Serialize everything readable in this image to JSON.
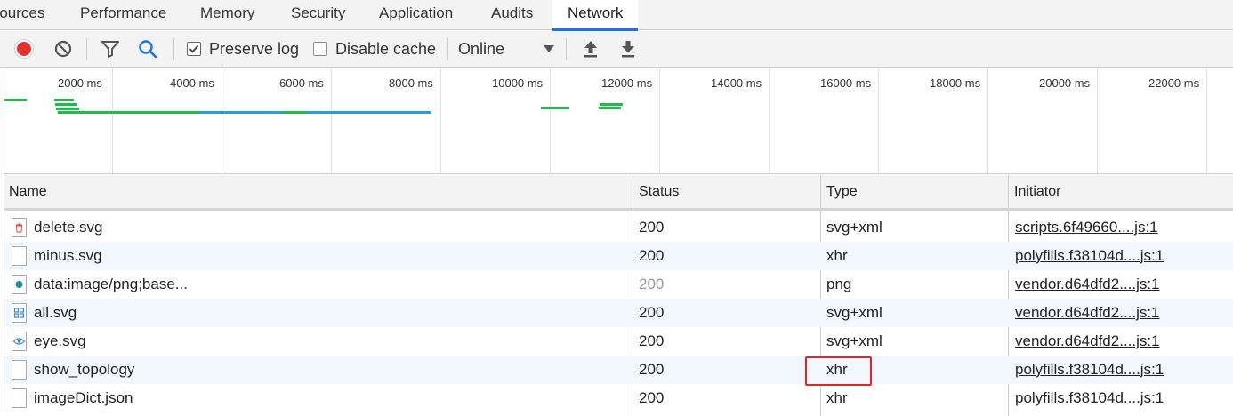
{
  "tabs": [
    "Sources",
    "Performance",
    "Memory",
    "Security",
    "Application",
    "Audits",
    "Network"
  ],
  "active_tab": "Network",
  "toolbar": {
    "preserve_log_label": "Preserve log",
    "preserve_log_checked": true,
    "disable_cache_label": "Disable cache",
    "disable_cache_checked": false,
    "throttling_value": "Online",
    "icons": [
      "record-icon",
      "clear-icon",
      "filter-icon",
      "search-icon",
      "import-icon",
      "export-icon"
    ],
    "record_color": "#e8302d",
    "search_color": "#1a73e8"
  },
  "overview": {
    "ticks": [
      "2000 ms",
      "4000 ms",
      "6000 ms",
      "8000 ms",
      "10000 ms",
      "12000 ms",
      "14000 ms",
      "16000 ms",
      "18000 ms",
      "20000 ms",
      "22000 ms"
    ],
    "colors": {
      "green": "#1fba4a",
      "blue": "#2a9be6"
    }
  },
  "table": {
    "columns": [
      "Name",
      "Status",
      "Type",
      "Initiator"
    ],
    "rows": [
      {
        "name": "delete.svg",
        "status": "200",
        "type": "svg+xml",
        "initiator": "scripts.6f49660....js:1",
        "icon": "delete-file-icon"
      },
      {
        "name": "minus.svg",
        "status": "200",
        "type": "xhr",
        "initiator": "polyfills.f38104d....js:1",
        "icon": "blank-file-icon"
      },
      {
        "name": "data:image/png;base...",
        "status": "200",
        "type": "png",
        "initiator": "vendor.d64dfd2....js:1",
        "icon": "image-file-icon",
        "status_dim": true
      },
      {
        "name": "all.svg",
        "status": "200",
        "type": "svg+xml",
        "initiator": "vendor.d64dfd2....js:1",
        "icon": "grid-file-icon"
      },
      {
        "name": "eye.svg",
        "status": "200",
        "type": "svg+xml",
        "initiator": "vendor.d64dfd2....js:1",
        "icon": "eye-file-icon"
      },
      {
        "name": "show_topology",
        "status": "200",
        "type": "xhr",
        "initiator": "polyfills.f38104d....js:1",
        "icon": "blank-file-icon",
        "highlighted": true
      },
      {
        "name": "imageDict.json",
        "status": "200",
        "type": "xhr",
        "initiator": "polyfills.f38104d....js:1",
        "icon": "blank-file-icon"
      }
    ],
    "highlight_color": "#e0262b"
  }
}
